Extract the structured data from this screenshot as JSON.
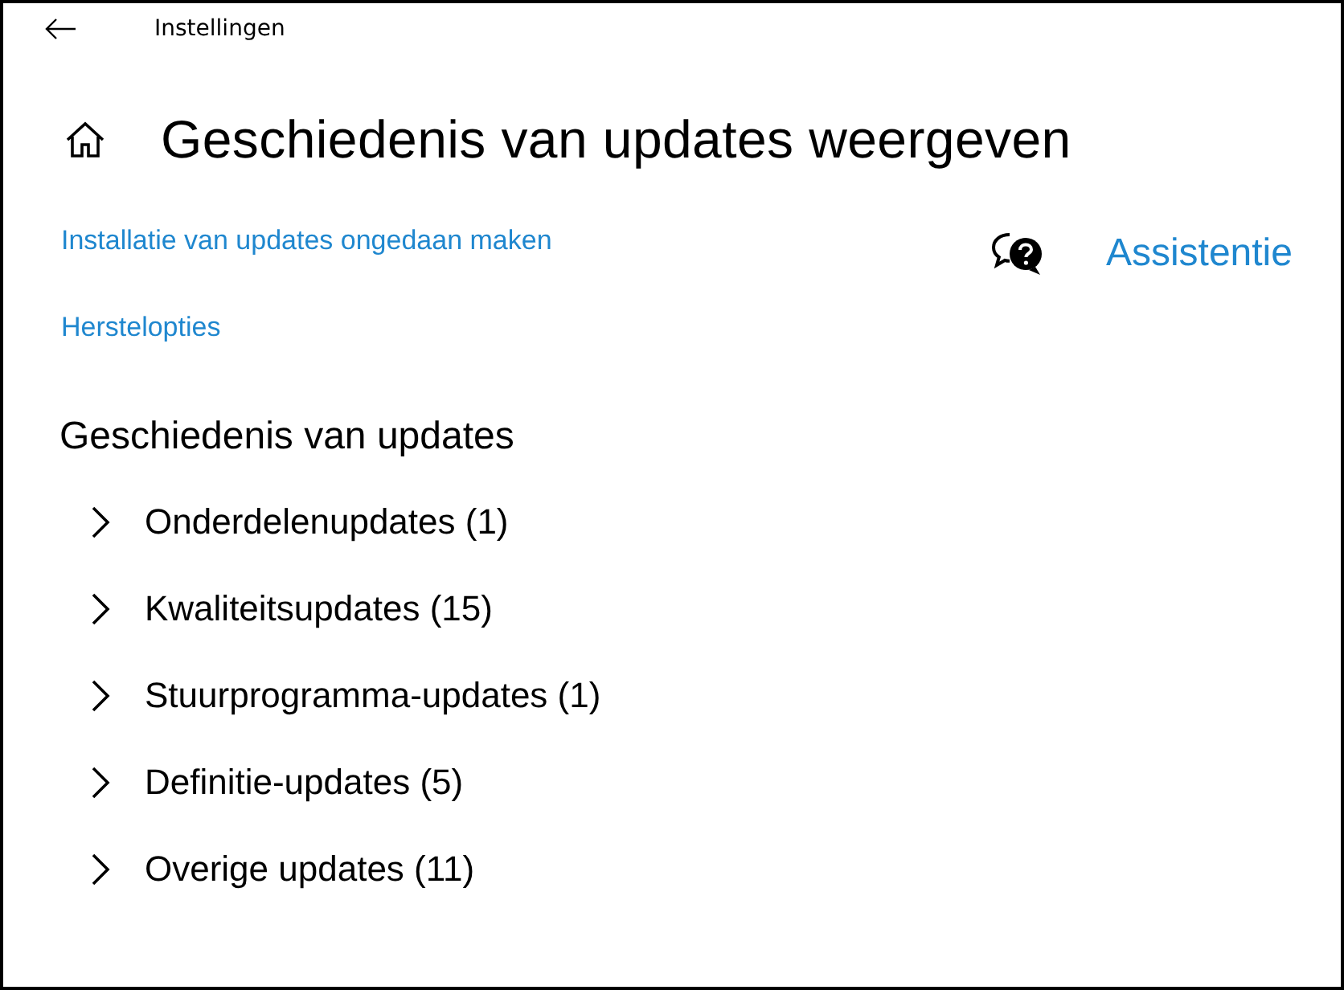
{
  "window": {
    "title": "Instellingen"
  },
  "page": {
    "title": "Geschiedenis van updates weergeven"
  },
  "links": [
    "Installatie van updates ongedaan maken",
    "Herstelopties"
  ],
  "help": {
    "label": "Assistentie"
  },
  "history": {
    "heading": "Geschiedenis van updates",
    "groups": [
      {
        "label": "Onderdelenupdates (1)",
        "expanded": false
      },
      {
        "label": "Kwaliteitsupdates (15)",
        "expanded": false
      },
      {
        "label": "Stuurprogramma-updates (1)",
        "expanded": false
      },
      {
        "label": "Definitie-updates (5)",
        "expanded": false
      },
      {
        "label": "Overige updates (11)",
        "expanded": false
      }
    ]
  }
}
